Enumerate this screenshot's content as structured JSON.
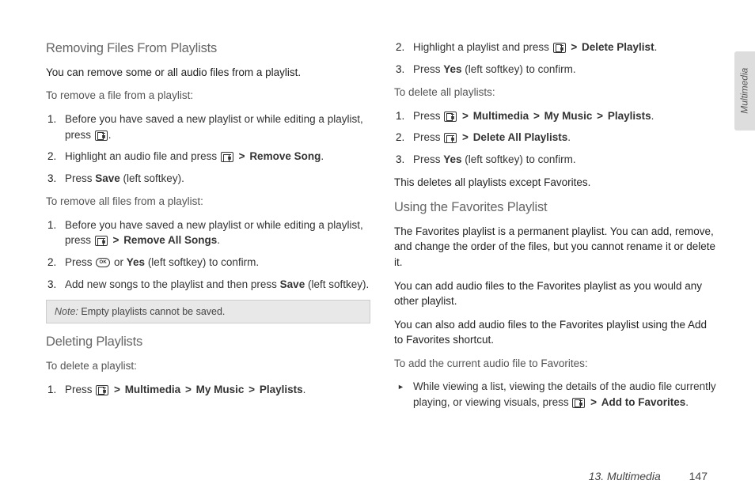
{
  "sideTab": "Multimedia",
  "footer": {
    "chapter": "13. Multimedia",
    "pageNumber": "147"
  },
  "col1": {
    "heading1": "Removing Files From Playlists",
    "p1": "You can remove some or all audio files from a playlist.",
    "intro1": "To remove a file from a playlist:",
    "list1": {
      "i1a": "Before you have saved a new playlist or while editing a playlist, press ",
      "i1b": ".",
      "i2a": "Highlight an audio file and press ",
      "i2b": "Remove Song",
      "i2c": ".",
      "i3a": "Press ",
      "i3b": "Save",
      "i3c": " (left softkey)."
    },
    "intro2": "To remove all files from a playlist:",
    "list2": {
      "i1a": "Before you have saved a new playlist or while editing a playlist, press ",
      "i1b": "Remove All Songs",
      "i1c": ".",
      "i2a": "Press ",
      "i2b": " or ",
      "i2c": "Yes",
      "i2d": " (left softkey) to confirm.",
      "i3a": "Add new songs to the playlist and then press ",
      "i3b": "Save",
      "i3c": " (left softkey)."
    },
    "noteLabel": "Note:",
    "noteText": " Empty playlists cannot be saved.",
    "heading2": "Deleting Playlists",
    "intro3": "To delete a playlist:",
    "list3": {
      "i1a": "Press ",
      "i1b": "Multimedia",
      "i1c": "My Music",
      "i1d": "Playlists",
      "i1e": "."
    }
  },
  "col2": {
    "list3cont": {
      "i2a": "Highlight a playlist and press ",
      "i2b": "Delete Playlist",
      "i2c": ".",
      "i3a": "Press ",
      "i3b": "Yes",
      "i3c": " (left softkey) to confirm."
    },
    "intro4": "To delete all playlists:",
    "list4": {
      "i1a": "Press ",
      "i1b": "Multimedia",
      "i1c": "My Music",
      "i1d": "Playlists",
      "i1e": ".",
      "i2a": "Press ",
      "i2b": "Delete All Playlists",
      "i2c": ".",
      "i3a": "Press ",
      "i3b": "Yes",
      "i3c": " (left softkey) to confirm."
    },
    "p2": "This deletes all playlists except Favorites.",
    "heading3": "Using the Favorites Playlist",
    "p3": "The Favorites playlist is a permanent playlist. You can add, remove, and change the order of the files, but you cannot rename it or delete it.",
    "p4": "You can add audio files to the Favorites playlist as you would any other playlist.",
    "p5": "You can also add audio files to the Favorites playlist using the Add to Favorites shortcut.",
    "intro5": "To add the current audio file to Favorites:",
    "list5": {
      "i1a": "While viewing a list, viewing the details of the audio file currently playing, or viewing visuals, press ",
      "i1b": "Add to Favorites",
      "i1c": "."
    }
  },
  "gt": ">",
  "ok": "OK"
}
